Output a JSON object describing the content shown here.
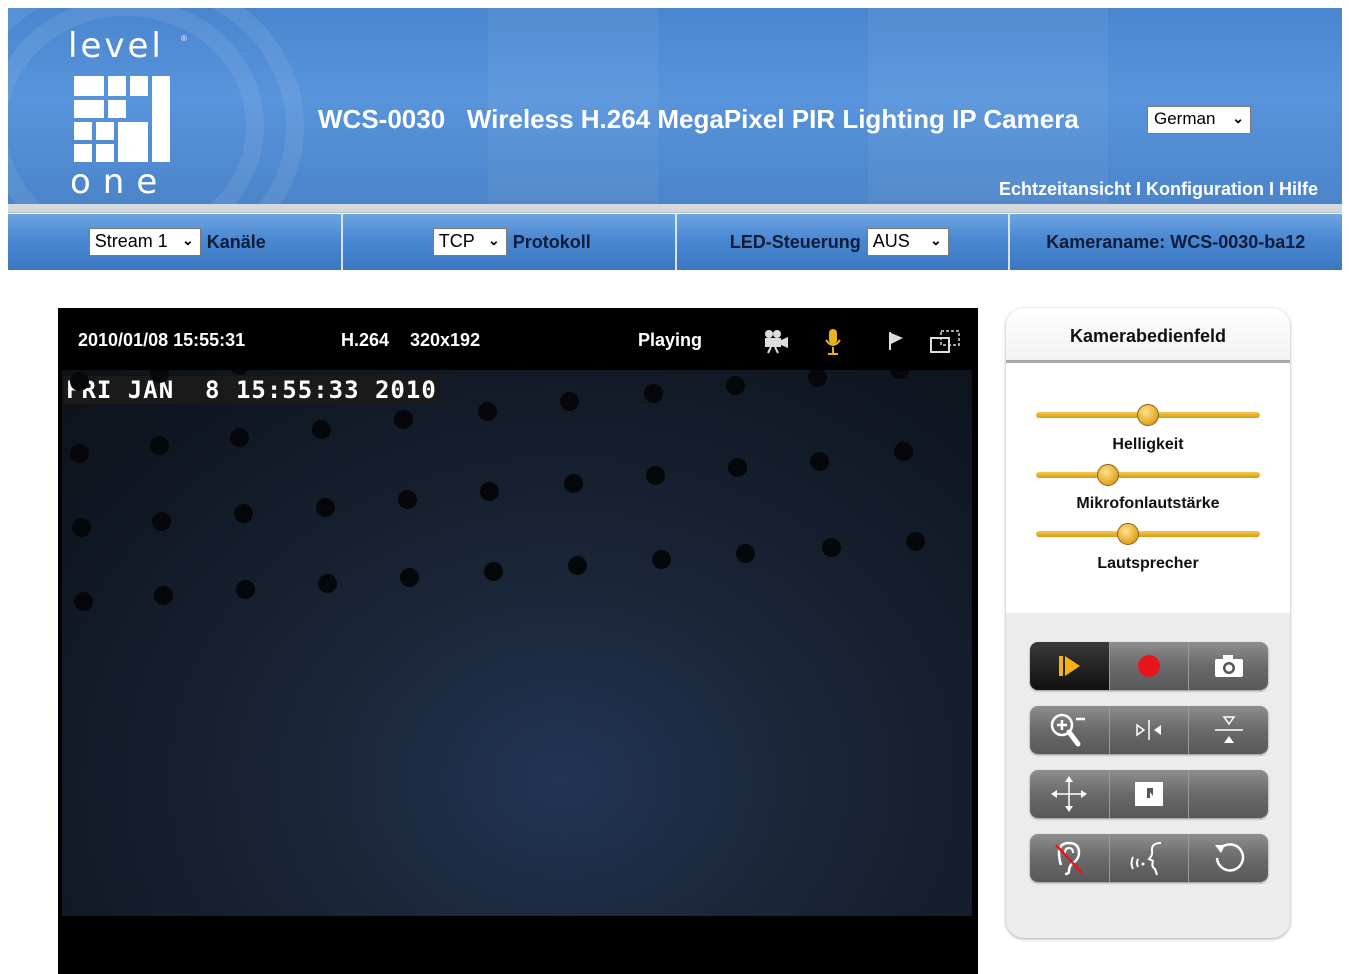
{
  "header": {
    "logo_top": "level",
    "logo_bottom": "one",
    "title": "WCS-0030   Wireless H.264 MegaPixel PIR Lighting IP Camera",
    "language": "German",
    "nav": [
      "Echtzeitansicht",
      "Konfiguration",
      "Hilfe"
    ],
    "nav_separator": "I"
  },
  "toolbar": {
    "stream_value": "Stream 1",
    "stream_label": "Kanäle",
    "protocol_value": "TCP",
    "protocol_label": "Protokoll",
    "led_label": "LED-Steuerung",
    "led_value": "AUS",
    "camera_name": "Kameraname: WCS-0030-ba12"
  },
  "video": {
    "datetime": "2010/01/08  15:55:31",
    "codec": "H.264",
    "resolution": "320x192",
    "status": "Playing",
    "osd_text": "FRI JAN  8 15:55:33 2010",
    "icons": [
      "video-camera-icon",
      "microphone-icon",
      "flag-icon",
      "window-icon"
    ]
  },
  "panel": {
    "title": "Kamerabedienfeld",
    "sliders": [
      {
        "label": "Helligkeit",
        "value": 0.5
      },
      {
        "label": "Mikrofonlautstärke",
        "value": 0.32
      },
      {
        "label": "Lautsprecher",
        "value": 0.41
      }
    ],
    "buttons": [
      [
        "play-icon",
        "record-icon",
        "snapshot-icon"
      ],
      [
        "zoom-icon",
        "mirror-icon",
        "flip-icon"
      ],
      [
        "move-icon",
        "crop-icon",
        "blank"
      ],
      [
        "listen-off-icon",
        "talk-icon",
        "reset-icon"
      ]
    ],
    "colors": {
      "slider": "#e0a520",
      "record": "#e8151c"
    }
  }
}
